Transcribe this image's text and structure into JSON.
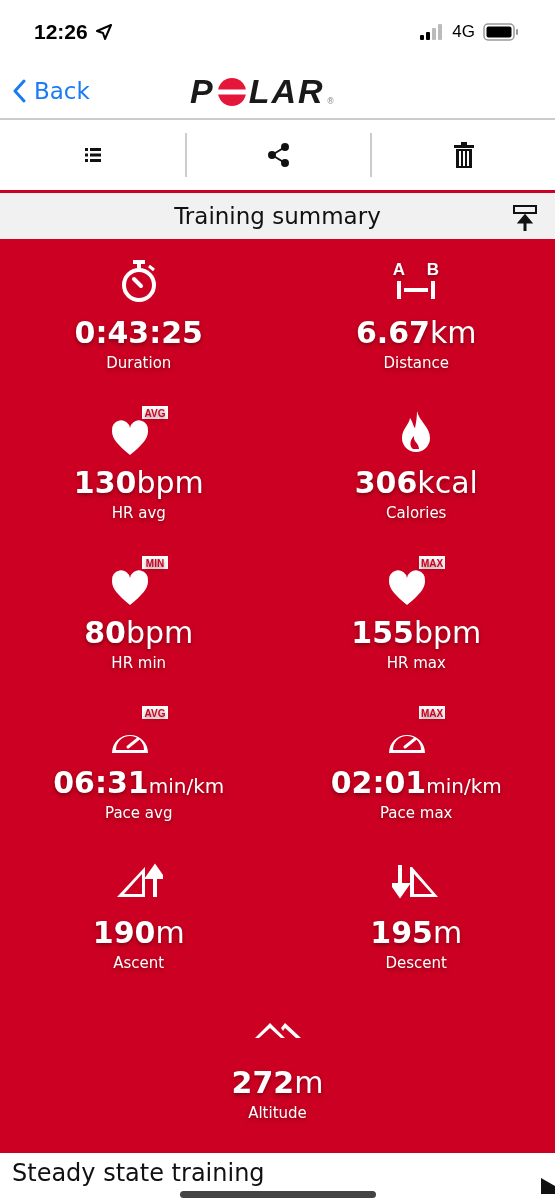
{
  "status_bar": {
    "time": "12:26",
    "network": "4G"
  },
  "nav": {
    "back": "Back",
    "logo": {
      "letters": [
        "P",
        "L",
        "A",
        "R"
      ],
      "mark": "®"
    }
  },
  "toolbar": [
    {
      "kind": "list"
    },
    {
      "kind": "share"
    },
    {
      "kind": "trash"
    }
  ],
  "section": {
    "title": "Training summary"
  },
  "stats": [
    {
      "kind": "stopwatch",
      "value": "0:43:25",
      "label": "Duration"
    },
    {
      "kind": "distance",
      "endpoints": [
        "A",
        "B"
      ],
      "value": "6.67",
      "unit": "km",
      "label": "Distance"
    },
    {
      "kind": "heart",
      "badge": "AVG",
      "value": "130",
      "unit": "bpm",
      "label": "HR avg"
    },
    {
      "kind": "flame",
      "value": "306",
      "unit": "kcal",
      "label": "Calories"
    },
    {
      "kind": "heart",
      "badge": "MIN",
      "value": "80",
      "unit": "bpm",
      "label": "HR min"
    },
    {
      "kind": "heart",
      "badge": "MAX",
      "value": "155",
      "unit": "bpm",
      "label": "HR max"
    },
    {
      "kind": "gauge",
      "badge": "AVG",
      "value": "06:31",
      "unit": "min/km",
      "small_unit": true,
      "label": "Pace avg"
    },
    {
      "kind": "gauge",
      "badge": "MAX",
      "value": "02:01",
      "unit": "min/km",
      "small_unit": true,
      "label": "Pace max"
    },
    {
      "kind": "ascent",
      "value": "190",
      "unit": "m",
      "label": "Ascent"
    },
    {
      "kind": "descent",
      "value": "195",
      "unit": "m",
      "label": "Descent"
    },
    {
      "kind": "mountain",
      "value": "272",
      "unit": "m",
      "label": "Altitude"
    }
  ],
  "footer": {
    "title": "Steady state training"
  }
}
